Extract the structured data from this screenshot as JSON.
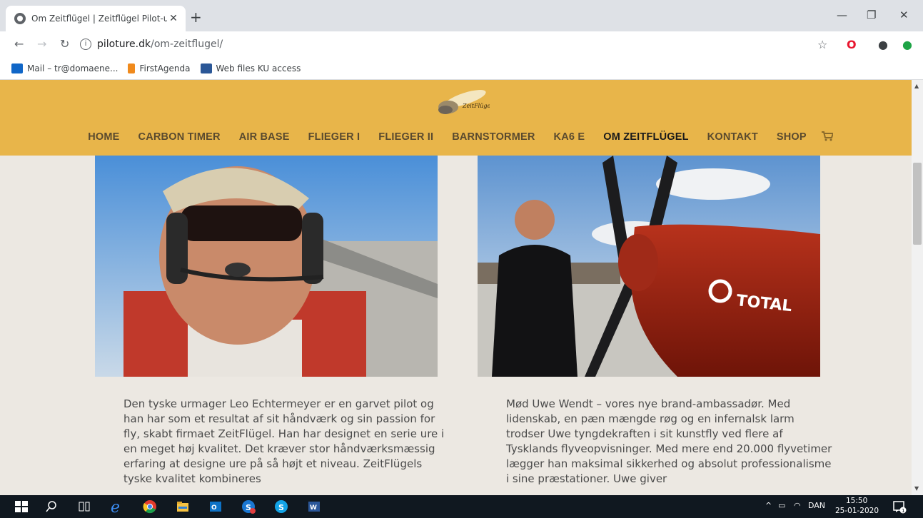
{
  "browser": {
    "tab_title": "Om Zeitflügel | Zeitflügel Pilot-ur",
    "tab_close": "✕",
    "new_tab": "+",
    "url_host": "piloture.dk",
    "url_path": "/om-zeitflugel/",
    "bookmarks": [
      {
        "label": "Mail – tr@domaene..."
      },
      {
        "label": "FirstAgenda"
      },
      {
        "label": "Web files KU access"
      }
    ]
  },
  "site": {
    "logo_text": "ZeitFlügel",
    "nav": [
      {
        "label": "HOME"
      },
      {
        "label": "CARBON TIMER"
      },
      {
        "label": "AIR BASE"
      },
      {
        "label": "FLIEGER I"
      },
      {
        "label": "FLIEGER II"
      },
      {
        "label": "BARNSTORMER"
      },
      {
        "label": "KA6 E"
      },
      {
        "label": "OM ZEITFLÜGEL"
      },
      {
        "label": "KONTAKT"
      },
      {
        "label": "SHOP"
      }
    ],
    "left_text": "Den tyske urmager Leo Echtermeyer er en garvet pilot og han har som et resultat af sit håndværk og sin passion for fly, skabt firmaet ZeitFlügel. Han har designet en serie ure i en meget høj kvalitet. Det kræver stor håndværksmæssig erfaring at designe ure på så højt et niveau. ZeitFlügels tyske kvalitet kombineres",
    "right_text": "Mød Uwe Wendt – vores nye brand-ambassadør. Med lidenskab, en pæn mængde røg og en infernalsk larm trodser Uwe tyngdekraften i sit kunstfly ved flere af Tysklands flyveopvisninger. Med mere end 20.000 flyvetimer lægger han maksimal sikkerhed og absolut professionalisme i sine præstationer. Uwe giver",
    "plane_logo_text": "TOTAL"
  },
  "taskbar": {
    "language": "DAN",
    "time": "15:50",
    "date": "25-01-2020",
    "notification_count": "1"
  },
  "colors": {
    "header": "#e8b54a",
    "nav_text": "#5a4a2e",
    "page_bg": "#ece8e2"
  }
}
